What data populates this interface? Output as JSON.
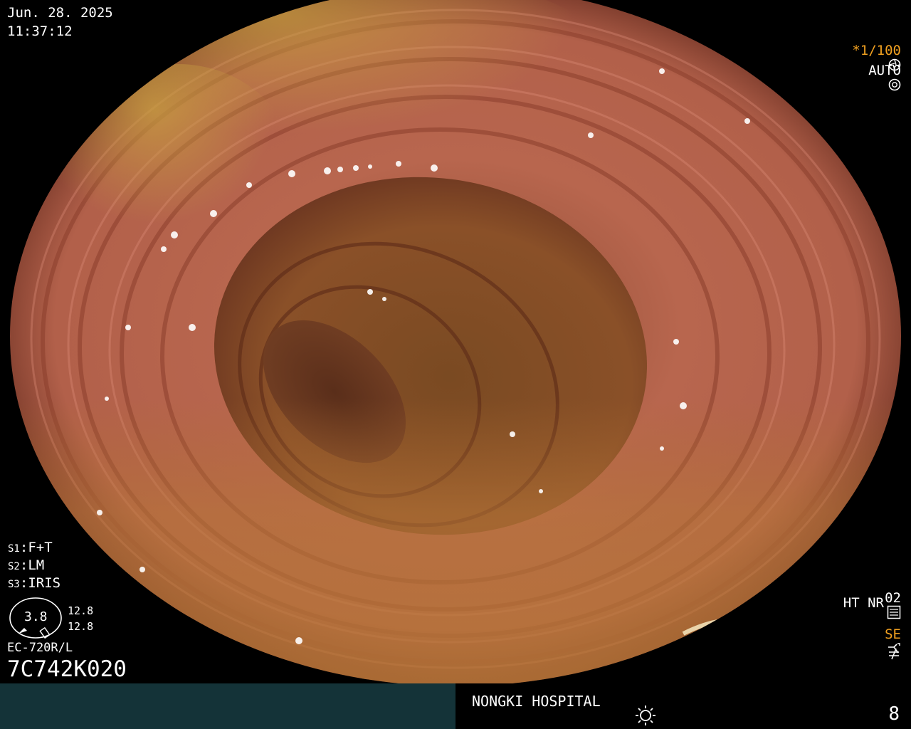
{
  "overlay": {
    "date": "Jun. 28. 2025",
    "time": "11:37:12",
    "shutter": "*1/100",
    "exposure_mode": "AUTO",
    "settings": [
      {
        "key": "S1",
        "value": "F+T"
      },
      {
        "key": "S2",
        "value": "LM"
      },
      {
        "key": "S3",
        "value": "IRIS"
      }
    ],
    "gauge_value": "3.8",
    "gauge_readings": [
      "12.8",
      "12.8"
    ],
    "scope_model": "EC-720R/L",
    "serial": "7C742K020",
    "channel": "02",
    "mode_labels": "HT NR",
    "se_label": "SE",
    "icons": [
      "shutter-icon",
      "auto-exposure-icon",
      "settings-card-icon",
      "se-icon",
      "not-equal-icon",
      "brightness-icon"
    ]
  },
  "footer": {
    "hospital": "NONGKI HOSPITAL",
    "page_number": "8"
  },
  "colors": {
    "accent": "#f0a020",
    "footer_panel": "#143338",
    "tissue": "#b0604a"
  }
}
